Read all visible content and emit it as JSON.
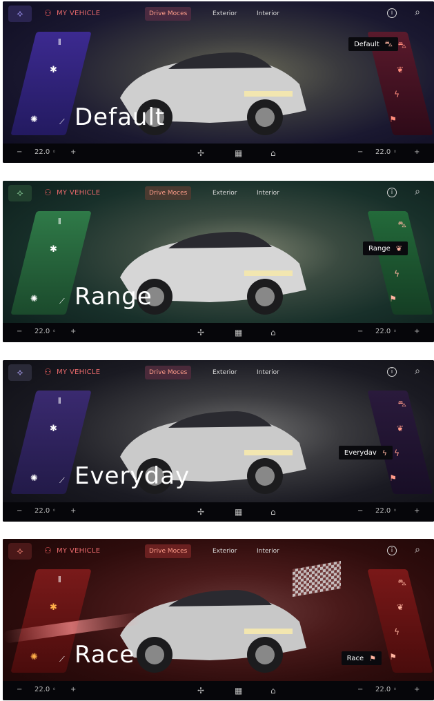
{
  "common": {
    "vehicle_label": "MY VEHICLE",
    "tabs": [
      "Drive Moces",
      "Exterior",
      "Interior"
    ],
    "temp_left": "22.0 ◦",
    "temp_right": "22.0 ◦",
    "minus": "−",
    "plus": "+"
  },
  "panels": [
    {
      "mode_title": "Default",
      "chip_label": "Default",
      "chip_icon": "car-icon"
    },
    {
      "mode_title": "Range",
      "chip_label": "Range",
      "chip_icon": "leaf-icon"
    },
    {
      "mode_title": "Everyday",
      "chip_label": "Everydav",
      "chip_icon": "bolt-icon"
    },
    {
      "mode_title": "Race",
      "chip_label": "Race",
      "chip_icon": "flag-icon"
    }
  ],
  "icons": {
    "home": "home-icon",
    "vehicle": "car-icon",
    "info": "info-icon",
    "search": "search-icon",
    "lane": "lane-icon",
    "snow": "snowflake-icon",
    "gear": "gear-icon",
    "wiper": "wiper-icon",
    "fan": "fan-icon",
    "grid": "grid-icon"
  },
  "colors": {
    "default_accent": "#3c2a90",
    "range_accent": "#2f7a48",
    "everyday_accent": "#3a2a70",
    "race_accent": "#7a1a1a",
    "chip_bg": "#0a0a0e"
  }
}
